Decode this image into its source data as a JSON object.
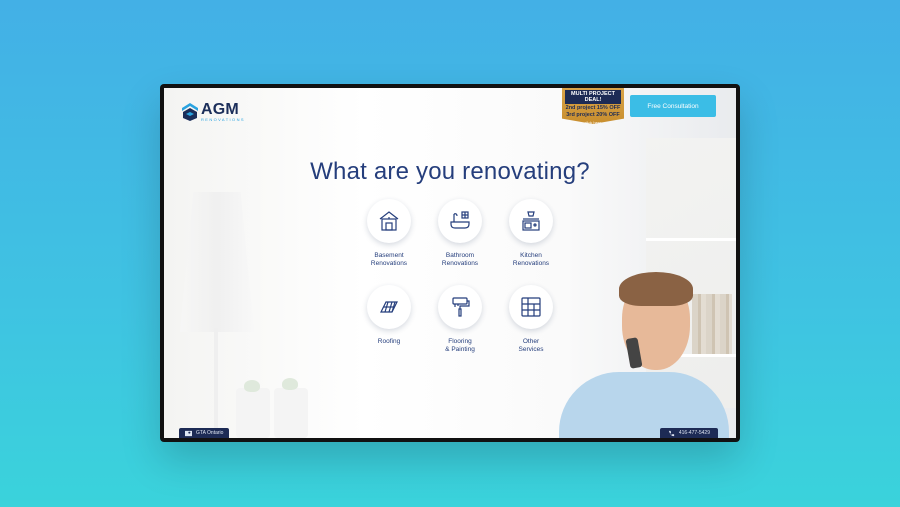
{
  "brand": {
    "name": "AGM",
    "tagline": "RENOVATIONS"
  },
  "promo": {
    "title": "MULTI PROJECT DEAL!",
    "line1": "2nd project 15% OFF",
    "line2": "3rd project 20% OFF",
    "cta": "click here"
  },
  "header": {
    "consult_label": "Free Consultation"
  },
  "main": {
    "heading": "What are you renovating?",
    "services": [
      {
        "label": "Basement\nRenovations",
        "icon": "basement-icon"
      },
      {
        "label": "Bathroom\nRenovations",
        "icon": "bathroom-icon"
      },
      {
        "label": "Kitchen\nRenovations",
        "icon": "kitchen-icon"
      },
      {
        "label": "Roofing",
        "icon": "roofing-icon"
      },
      {
        "label": "Flooring\n& Painting",
        "icon": "paint-roller-icon"
      },
      {
        "label": "Other\nServices",
        "icon": "tools-icon"
      }
    ]
  },
  "footer": {
    "location": "GTA Ontario",
    "phone": "416-477-5429"
  },
  "colors": {
    "accent": "#3bbde6",
    "navy": "#1d2b55",
    "heading": "#253e7c",
    "promo_gold": "#d9a44a"
  }
}
